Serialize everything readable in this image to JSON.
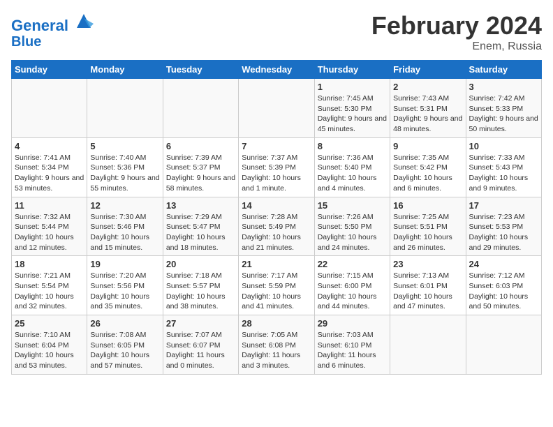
{
  "header": {
    "logo_line1": "General",
    "logo_line2": "Blue",
    "month_title": "February 2024",
    "location": "Enem, Russia"
  },
  "days_of_week": [
    "Sunday",
    "Monday",
    "Tuesday",
    "Wednesday",
    "Thursday",
    "Friday",
    "Saturday"
  ],
  "weeks": [
    [
      {
        "num": "",
        "info": ""
      },
      {
        "num": "",
        "info": ""
      },
      {
        "num": "",
        "info": ""
      },
      {
        "num": "",
        "info": ""
      },
      {
        "num": "1",
        "info": "Sunrise: 7:45 AM\nSunset: 5:30 PM\nDaylight: 9 hours and 45 minutes."
      },
      {
        "num": "2",
        "info": "Sunrise: 7:43 AM\nSunset: 5:31 PM\nDaylight: 9 hours and 48 minutes."
      },
      {
        "num": "3",
        "info": "Sunrise: 7:42 AM\nSunset: 5:33 PM\nDaylight: 9 hours and 50 minutes."
      }
    ],
    [
      {
        "num": "4",
        "info": "Sunrise: 7:41 AM\nSunset: 5:34 PM\nDaylight: 9 hours and 53 minutes."
      },
      {
        "num": "5",
        "info": "Sunrise: 7:40 AM\nSunset: 5:36 PM\nDaylight: 9 hours and 55 minutes."
      },
      {
        "num": "6",
        "info": "Sunrise: 7:39 AM\nSunset: 5:37 PM\nDaylight: 9 hours and 58 minutes."
      },
      {
        "num": "7",
        "info": "Sunrise: 7:37 AM\nSunset: 5:39 PM\nDaylight: 10 hours and 1 minute."
      },
      {
        "num": "8",
        "info": "Sunrise: 7:36 AM\nSunset: 5:40 PM\nDaylight: 10 hours and 4 minutes."
      },
      {
        "num": "9",
        "info": "Sunrise: 7:35 AM\nSunset: 5:42 PM\nDaylight: 10 hours and 6 minutes."
      },
      {
        "num": "10",
        "info": "Sunrise: 7:33 AM\nSunset: 5:43 PM\nDaylight: 10 hours and 9 minutes."
      }
    ],
    [
      {
        "num": "11",
        "info": "Sunrise: 7:32 AM\nSunset: 5:44 PM\nDaylight: 10 hours and 12 minutes."
      },
      {
        "num": "12",
        "info": "Sunrise: 7:30 AM\nSunset: 5:46 PM\nDaylight: 10 hours and 15 minutes."
      },
      {
        "num": "13",
        "info": "Sunrise: 7:29 AM\nSunset: 5:47 PM\nDaylight: 10 hours and 18 minutes."
      },
      {
        "num": "14",
        "info": "Sunrise: 7:28 AM\nSunset: 5:49 PM\nDaylight: 10 hours and 21 minutes."
      },
      {
        "num": "15",
        "info": "Sunrise: 7:26 AM\nSunset: 5:50 PM\nDaylight: 10 hours and 24 minutes."
      },
      {
        "num": "16",
        "info": "Sunrise: 7:25 AM\nSunset: 5:51 PM\nDaylight: 10 hours and 26 minutes."
      },
      {
        "num": "17",
        "info": "Sunrise: 7:23 AM\nSunset: 5:53 PM\nDaylight: 10 hours and 29 minutes."
      }
    ],
    [
      {
        "num": "18",
        "info": "Sunrise: 7:21 AM\nSunset: 5:54 PM\nDaylight: 10 hours and 32 minutes."
      },
      {
        "num": "19",
        "info": "Sunrise: 7:20 AM\nSunset: 5:56 PM\nDaylight: 10 hours and 35 minutes."
      },
      {
        "num": "20",
        "info": "Sunrise: 7:18 AM\nSunset: 5:57 PM\nDaylight: 10 hours and 38 minutes."
      },
      {
        "num": "21",
        "info": "Sunrise: 7:17 AM\nSunset: 5:59 PM\nDaylight: 10 hours and 41 minutes."
      },
      {
        "num": "22",
        "info": "Sunrise: 7:15 AM\nSunset: 6:00 PM\nDaylight: 10 hours and 44 minutes."
      },
      {
        "num": "23",
        "info": "Sunrise: 7:13 AM\nSunset: 6:01 PM\nDaylight: 10 hours and 47 minutes."
      },
      {
        "num": "24",
        "info": "Sunrise: 7:12 AM\nSunset: 6:03 PM\nDaylight: 10 hours and 50 minutes."
      }
    ],
    [
      {
        "num": "25",
        "info": "Sunrise: 7:10 AM\nSunset: 6:04 PM\nDaylight: 10 hours and 53 minutes."
      },
      {
        "num": "26",
        "info": "Sunrise: 7:08 AM\nSunset: 6:05 PM\nDaylight: 10 hours and 57 minutes."
      },
      {
        "num": "27",
        "info": "Sunrise: 7:07 AM\nSunset: 6:07 PM\nDaylight: 11 hours and 0 minutes."
      },
      {
        "num": "28",
        "info": "Sunrise: 7:05 AM\nSunset: 6:08 PM\nDaylight: 11 hours and 3 minutes."
      },
      {
        "num": "29",
        "info": "Sunrise: 7:03 AM\nSunset: 6:10 PM\nDaylight: 11 hours and 6 minutes."
      },
      {
        "num": "",
        "info": ""
      },
      {
        "num": "",
        "info": ""
      }
    ]
  ]
}
